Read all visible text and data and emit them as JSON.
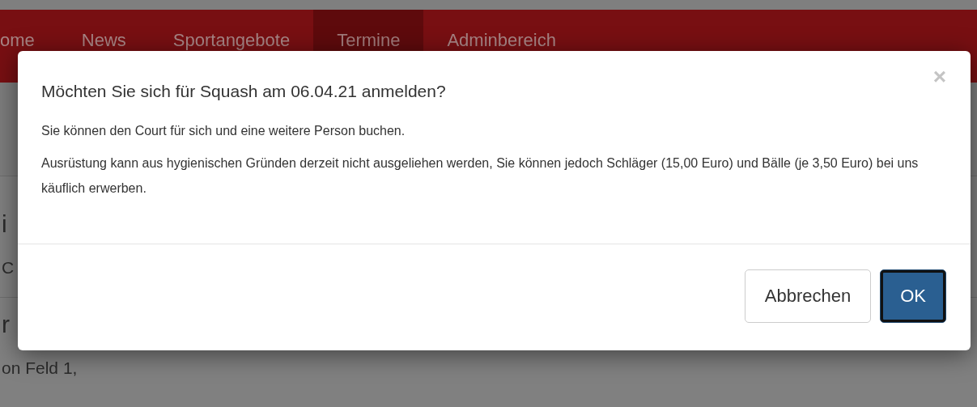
{
  "nav": {
    "items": [
      {
        "label": "ome",
        "selected": false
      },
      {
        "label": "News",
        "selected": false
      },
      {
        "label": "Sportangebote",
        "selected": false
      },
      {
        "label": "Termine",
        "selected": true
      },
      {
        "label": "Adminbereich",
        "selected": false
      }
    ]
  },
  "page": {
    "sections": [
      {
        "items": [
          {
            "kind": "heading",
            "text": "i"
          },
          {
            "kind": "text",
            "text": "C"
          }
        ]
      },
      {
        "items": [
          {
            "kind": "heading",
            "text": "r"
          },
          {
            "kind": "text",
            "text": "on Feld 1,"
          }
        ]
      }
    ]
  },
  "dialog": {
    "title": "Möchten Sie sich für Squash am 06.04.21 anmelden?",
    "close": "×",
    "paragraphs": [
      "Sie können den Court für sich und eine weitere Person buchen.",
      "Ausrüstung kann aus hygienischen Gründen derzeit nicht ausgeliehen werden, Sie können jedoch Schläger (15,00 Euro) und Bälle (je 3,50 Euro) bei uns käuflich erwerben."
    ],
    "buttons": [
      {
        "label": "Abbrechen",
        "kind": "default",
        "focused": false
      },
      {
        "label": "OK",
        "kind": "primary",
        "focused": true
      }
    ]
  }
}
